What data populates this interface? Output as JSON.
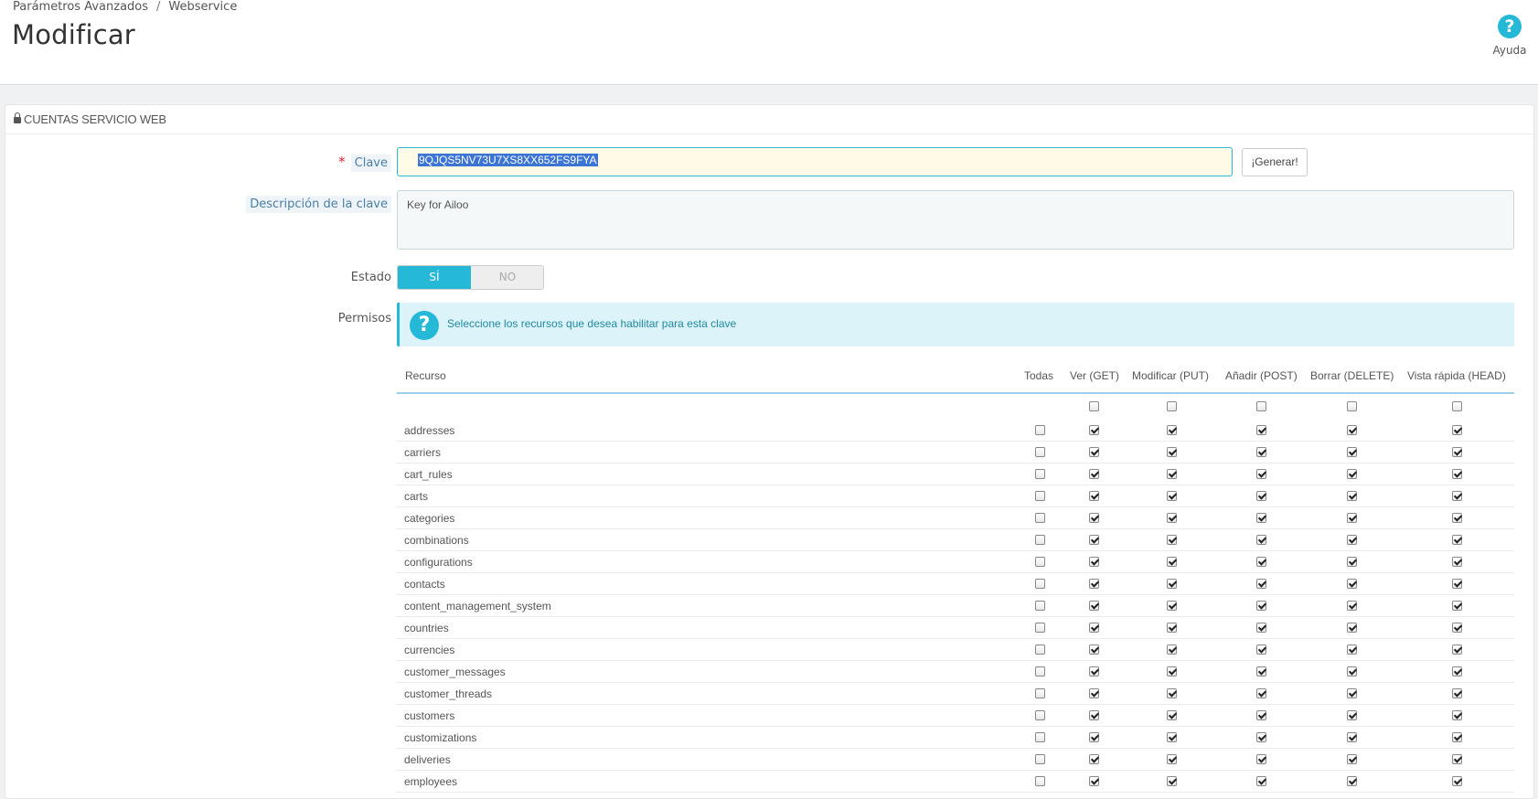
{
  "breadcrumb": {
    "items": [
      "Parámetros Avanzados",
      "Webservice"
    ],
    "separator": "/"
  },
  "page_title": "Modificar",
  "help": {
    "label": "Ayuda",
    "icon": "question-circle-icon"
  },
  "panel": {
    "title": "CUENTAS SERVICIO WEB",
    "icon": "lock-icon"
  },
  "form": {
    "key": {
      "label": "Clave",
      "required_mark": "*",
      "value": "9QJQS5NV73U7XS8XX652FS9FYA",
      "generate_label": "¡Generar!"
    },
    "description": {
      "label": "Descripción de la clave",
      "value": "Key for Ailoo"
    },
    "status": {
      "label": "Estado",
      "on_label": "SÍ",
      "off_label": "NO",
      "value": true
    },
    "permissions": {
      "label": "Permisos",
      "info_text": "Seleccione los recursos que desea habilitar para esta clave",
      "info_icon": "question-circle-icon"
    }
  },
  "table": {
    "headers": [
      "Recurso",
      "Todas",
      "Ver (GET)",
      "Modificar (PUT)",
      "Añadir (POST)",
      "Borrar (DELETE)",
      "Vista rápida (HEAD)"
    ],
    "select_all_checked": [
      false,
      false,
      false,
      false,
      false
    ],
    "rows": [
      {
        "resource": "addresses",
        "all": false,
        "get": true,
        "put": true,
        "post": true,
        "delete": true,
        "head": true
      },
      {
        "resource": "carriers",
        "all": false,
        "get": true,
        "put": true,
        "post": true,
        "delete": true,
        "head": true
      },
      {
        "resource": "cart_rules",
        "all": false,
        "get": true,
        "put": true,
        "post": true,
        "delete": true,
        "head": true
      },
      {
        "resource": "carts",
        "all": false,
        "get": true,
        "put": true,
        "post": true,
        "delete": true,
        "head": true
      },
      {
        "resource": "categories",
        "all": false,
        "get": true,
        "put": true,
        "post": true,
        "delete": true,
        "head": true
      },
      {
        "resource": "combinations",
        "all": false,
        "get": true,
        "put": true,
        "post": true,
        "delete": true,
        "head": true
      },
      {
        "resource": "configurations",
        "all": false,
        "get": true,
        "put": true,
        "post": true,
        "delete": true,
        "head": true
      },
      {
        "resource": "contacts",
        "all": false,
        "get": true,
        "put": true,
        "post": true,
        "delete": true,
        "head": true
      },
      {
        "resource": "content_management_system",
        "all": false,
        "get": true,
        "put": true,
        "post": true,
        "delete": true,
        "head": true
      },
      {
        "resource": "countries",
        "all": false,
        "get": true,
        "put": true,
        "post": true,
        "delete": true,
        "head": true
      },
      {
        "resource": "currencies",
        "all": false,
        "get": true,
        "put": true,
        "post": true,
        "delete": true,
        "head": true
      },
      {
        "resource": "customer_messages",
        "all": false,
        "get": true,
        "put": true,
        "post": true,
        "delete": true,
        "head": true
      },
      {
        "resource": "customer_threads",
        "all": false,
        "get": true,
        "put": true,
        "post": true,
        "delete": true,
        "head": true
      },
      {
        "resource": "customers",
        "all": false,
        "get": true,
        "put": true,
        "post": true,
        "delete": true,
        "head": true
      },
      {
        "resource": "customizations",
        "all": false,
        "get": true,
        "put": true,
        "post": true,
        "delete": true,
        "head": true
      },
      {
        "resource": "deliveries",
        "all": false,
        "get": true,
        "put": true,
        "post": true,
        "delete": true,
        "head": true
      },
      {
        "resource": "employees",
        "all": false,
        "get": true,
        "put": true,
        "post": true,
        "delete": true,
        "head": true
      }
    ]
  },
  "colors": {
    "accent": "#25b9d7",
    "alert_bg": "#dcf4f9",
    "key_input_bg": "#fffbe6"
  }
}
